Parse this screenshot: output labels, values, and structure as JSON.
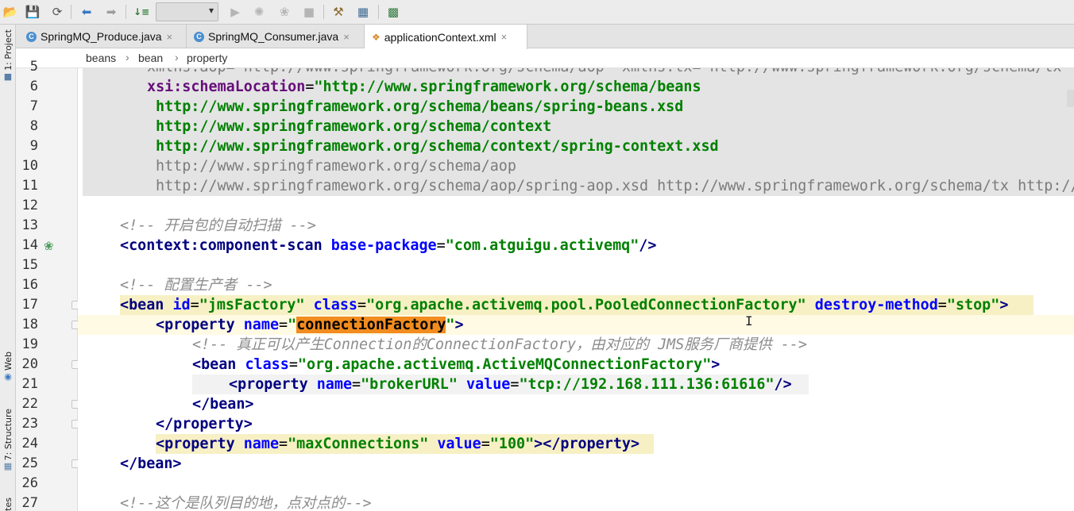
{
  "toolbar": {
    "icons": [
      "open-folder-icon",
      "save-icon",
      "sync-icon",
      "back-arrow-icon",
      "forward-arrow-icon",
      "build-icon",
      "run-configuration-dropdown",
      "run-icon",
      "debug-icon",
      "coverage-icon",
      "stop-icon",
      "project-structure-icon",
      "sdk-icon",
      "terminal-icon"
    ],
    "run_config_value": "",
    "dropdown_arrow": "▾"
  },
  "left_bar": {
    "project": "1: Project",
    "web": "Web",
    "structure": "7: Structure",
    "favorites": "tes"
  },
  "tabs": [
    {
      "label": "SpringMQ_Produce.java",
      "icon": "C",
      "close": "×",
      "active": false
    },
    {
      "label": "SpringMQ_Consumer.java",
      "icon": "C",
      "close": "×",
      "active": false
    },
    {
      "label": "applicationContext.xml",
      "icon": "xml-file-icon",
      "close": "×",
      "active": true
    }
  ],
  "breadcrumb": {
    "items": [
      "beans",
      "bean",
      "property"
    ],
    "separator": "›"
  },
  "editor": {
    "line_numbers": [
      "5",
      "6",
      "7",
      "8",
      "9",
      "10",
      "11",
      "12",
      "13",
      "14",
      "15",
      "16",
      "17",
      "18",
      "19",
      "20",
      "21",
      "22",
      "23",
      "24",
      "25",
      "26",
      "27"
    ],
    "lines": {
      "l5": "xmlns:aop=\"http://www.springframework.org/schema/aop\" xmlns:tx=\"http://www.springframework.org/schema/tx\"",
      "l6_attr": "xsi:schemaLocation",
      "l6_punc": "=",
      "l6_val": "\"http://www.springframework.org/schema/beans",
      "l7": "http://www.springframework.org/schema/beans/spring-beans.xsd",
      "l8": "http://www.springframework.org/schema/context",
      "l9": "http://www.springframework.org/schema/context/spring-context.xsd",
      "l10": "http://www.springframework.org/schema/aop",
      "l11": "http://www.springframework.org/schema/aop/spring-aop.xsd http://www.springframework.org/schema/tx http://www.springframework.org/schema/tx/spring-tx.xsd\">",
      "l13": "<!-- 开启包的自动扫描 -->",
      "l14_open": "<context:component-scan",
      "l14_attr": "base-package",
      "l14_eq": "=",
      "l14_val": "\"com.atguigu.activemq\"",
      "l14_close": "/>",
      "l16": "<!-- 配置生产者 -->",
      "l17_open": "<bean",
      "l17_a1": "id",
      "l17_v1": "\"jmsFactory\"",
      "l17_a2": "class",
      "l17_v2": "\"org.apache.activemq.pool.PooledConnectionFactory\"",
      "l17_a3": "destroy-method",
      "l17_v3": "\"stop\"",
      "l17_close": ">",
      "l18_open": "<property",
      "l18_a1": "name",
      "l18_q1": "\"",
      "l18_match": "connectionFactory",
      "l18_q2": "\"",
      "l18_close": ">",
      "l19": "<!-- 真正可以产生Connection的ConnectionFactory，由对应的 JMS服务厂商提供 -->",
      "l20_open": "<bean",
      "l20_a1": "class",
      "l20_v1": "\"org.apache.activemq.ActiveMQConnectionFactory\"",
      "l20_close": ">",
      "l21_open": "<property",
      "l21_a1": "name",
      "l21_v1": "\"brokerURL\"",
      "l21_a2": "value",
      "l21_v2": "\"tcp://192.168.111.136:61616\"",
      "l21_close": "/>",
      "l22": "</bean>",
      "l23": "</property>",
      "l24_open": "<property",
      "l24_a1": "name",
      "l24_v1": "\"maxConnections\"",
      "l24_a2": "value",
      "l24_v2": "\"100\"",
      "l24_close": "></property>",
      "l25": "</bean>",
      "l27": "<!--这个是队列目的地，点对点的-->"
    },
    "eq": "="
  },
  "colors": {
    "tag": "#000080",
    "attribute": "#0000ff",
    "value": "#008000",
    "comment": "#8c8c8c",
    "caret_line": "#fffae3",
    "selection_bg": "#e4e4e4",
    "match_highlight": "#f28c1f",
    "tag_highlight": "#f7f0c4"
  },
  "gutter_icons": {
    "line14": "spring-bean-icon",
    "line18": "lightbulb-icon"
  },
  "text_cursor": "I"
}
